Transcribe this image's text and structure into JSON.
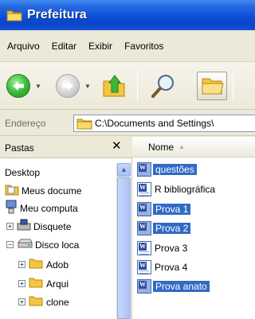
{
  "window": {
    "title": "Prefeitura"
  },
  "menu": [
    "Arquivo",
    "Editar",
    "Exibir",
    "Favoritos"
  ],
  "address": {
    "label": "Endereço",
    "path": "C:\\Documents and Settings\\"
  },
  "left_pane": {
    "title": "Pastas",
    "tree": [
      {
        "label": "Desktop",
        "expander": ""
      },
      {
        "label": "Meus docume",
        "expander": ""
      },
      {
        "label": "Meu computa",
        "expander": ""
      },
      {
        "label": "Disquete",
        "expander": "+"
      },
      {
        "label": "Disco loca",
        "expander": "−"
      },
      {
        "label": "Adob",
        "expander": "+"
      },
      {
        "label": "Arqui",
        "expander": "+"
      },
      {
        "label": "clone",
        "expander": "+"
      }
    ]
  },
  "right_pane": {
    "column_name": "Nome",
    "files": [
      {
        "name": "questões",
        "selected": true
      },
      {
        "name": "R  bibliográfica",
        "selected": false
      },
      {
        "name": "Prova 1",
        "selected": true
      },
      {
        "name": "Prova 2",
        "selected": true
      },
      {
        "name": "Prova 3",
        "selected": false
      },
      {
        "name": "Prova 4",
        "selected": false
      },
      {
        "name": "Prova anato",
        "selected": true
      }
    ]
  },
  "colors": {
    "titlebar": "#0b4fd8",
    "selection": "#316ac5",
    "chrome": "#ece9d8"
  }
}
